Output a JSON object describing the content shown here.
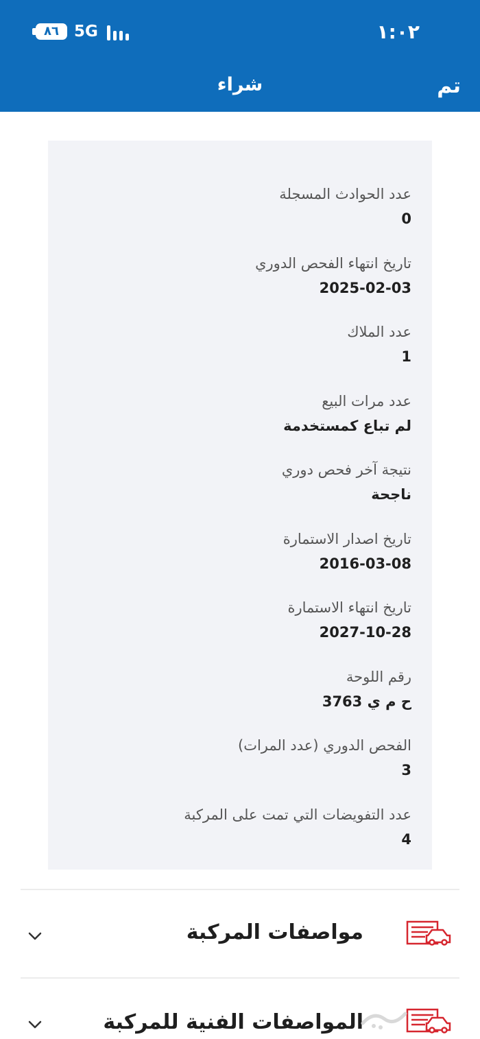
{
  "status_bar": {
    "time": "١:٠٢",
    "battery": "٨٦",
    "network": "5G"
  },
  "header": {
    "title": "شراء",
    "done_label": "تم"
  },
  "details": [
    {
      "label": "عدد الحوادث المسجلة",
      "value": "0"
    },
    {
      "label": "تاريخ انتهاء الفحص الدوري",
      "value": "2025-02-03"
    },
    {
      "label": "عدد الملاك",
      "value": "1"
    },
    {
      "label": "عدد مرات البيع",
      "value": "لم تباع كمستخدمة"
    },
    {
      "label": "نتيجة آخر فحص دوري",
      "value": "ناجحة"
    },
    {
      "label": "تاريخ اصدار الاستمارة",
      "value": "2016-03-08"
    },
    {
      "label": "تاريخ انتهاء الاستمارة",
      "value": "2027-10-28"
    },
    {
      "label": "رقم اللوحة",
      "value": "ح م ي 3763"
    },
    {
      "label": "الفحص الدوري (عدد المرات)",
      "value": "3"
    },
    {
      "label": "عدد التفويضات التي تمت على المركبة",
      "value": "4"
    }
  ],
  "sections": [
    {
      "title": "مواصفات المركبة",
      "icon": "car-document-icon"
    },
    {
      "title": "المواصفات الفنية للمركبة",
      "icon": "car-document-icon"
    }
  ],
  "colors": {
    "header": "#0f6dbb",
    "panel": "#f2f3f7",
    "icon_red": "#d6262f"
  }
}
